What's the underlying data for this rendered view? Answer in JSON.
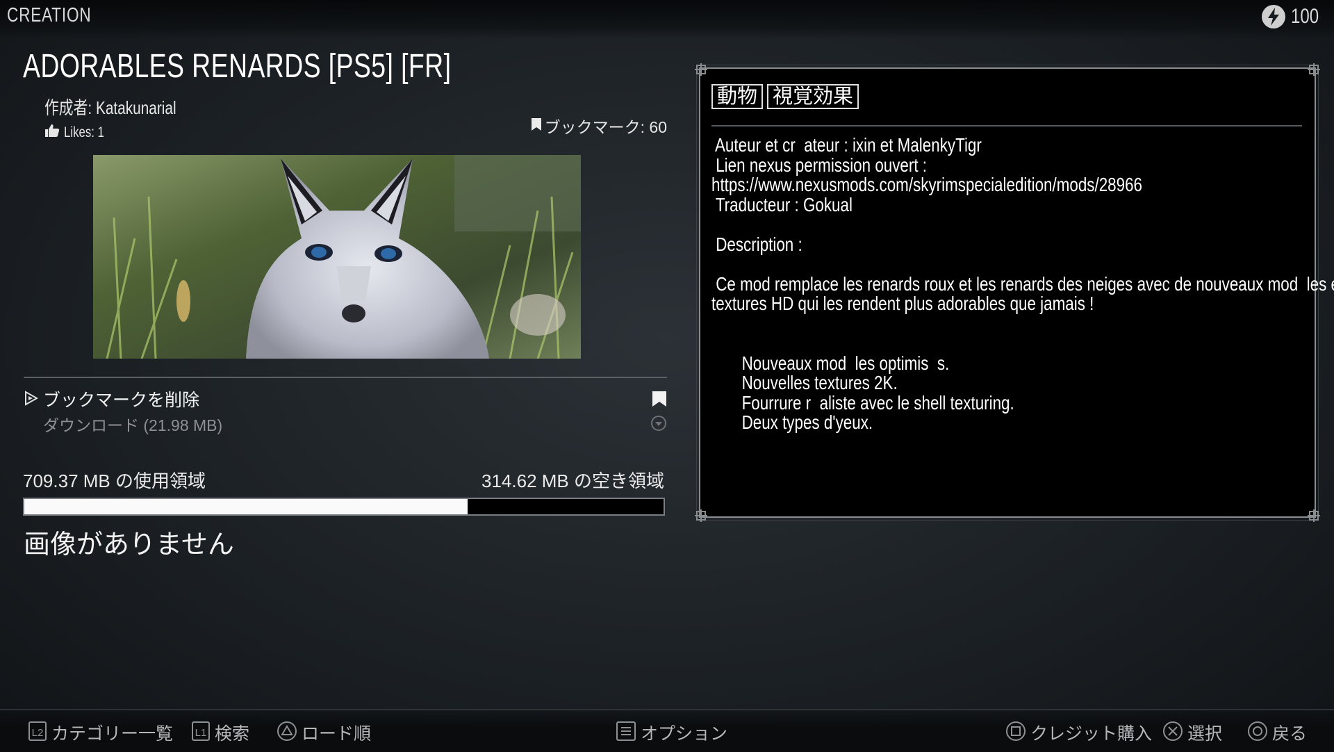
{
  "header": {
    "title": "CREATION",
    "credits": "100",
    "credits_icon": "lightning-bolt-icon"
  },
  "mod": {
    "title": "ADORABLES RENARDS [PS5] [FR]",
    "author": "作成者: Katakunarial",
    "likes": "Likes: 1",
    "bookmarks": "ブックマーク: 60",
    "tags": [
      "動物",
      "視覚効果"
    ],
    "description": [
      " Auteur et cr  ateur : ixin et MalenkyTigr",
      " Lien nexus permission ouvert :",
      "https://www.nexusmods.com/skyrimspecialedition/mods/28966",
      " Traducteur : Gokual",
      "",
      " Description :",
      "",
      " Ce mod remplace les renards roux et les renards des neiges avec de nouveaux mod  les et des",
      "textures HD qui les rendent plus adorables que jamais !",
      "",
      "",
      "       Nouveaux mod  les optimis  s.",
      "       Nouvelles textures 2K.",
      "       Fourrure r  aliste avec le shell texturing.",
      "       Deux types d'yeux."
    ]
  },
  "actions": {
    "remove_bookmark": "ブックマークを削除",
    "download": "ダウンロード (21.98 MB)"
  },
  "storage": {
    "used": "709.37 MB の使用領域",
    "free": "314.62 MB の空き領域",
    "used_fraction": 0.693
  },
  "no_image": "画像がありません",
  "footer": {
    "hints": [
      {
        "icon": "l2-button-icon",
        "label": "カテゴリー一覧"
      },
      {
        "icon": "l1-button-icon",
        "label": "検索"
      },
      {
        "icon": "triangle-button-icon",
        "label": "ロード順"
      },
      {
        "icon": "options-button-icon",
        "label": "オプション"
      },
      {
        "icon": "square-button-icon",
        "label": "クレジット購入"
      },
      {
        "icon": "cross-button-icon",
        "label": "選択"
      },
      {
        "icon": "circle-button-icon",
        "label": "戻る"
      }
    ]
  },
  "colors": {
    "background": "#1c2125",
    "panel": "#000000",
    "text": "#ffffff",
    "muted": "#8e9194",
    "bar_fill": "#fafafa"
  }
}
